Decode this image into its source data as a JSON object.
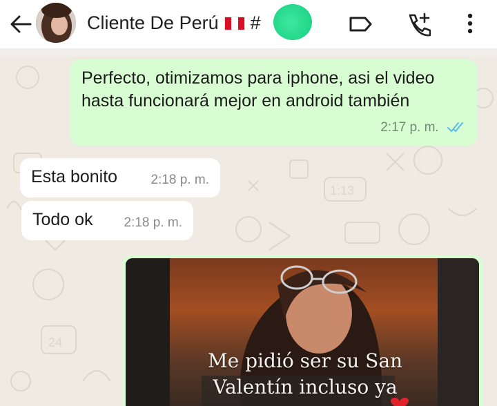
{
  "header": {
    "contact_name": "Cliente De Perú",
    "hash": "#",
    "icons": [
      "back-arrow-icon",
      "label-icon",
      "add-call-icon",
      "more-vert-icon"
    ]
  },
  "messages": [
    {
      "direction": "out",
      "text": "Perfecto, otimizamos para iphone, asi el video hasta funcionará mejor en android también",
      "time": "2:17 p. m.",
      "status": "read"
    },
    {
      "direction": "in",
      "text": "Esta bonito",
      "time": "2:18 p. m."
    },
    {
      "direction": "in",
      "text": "Todo ok",
      "time": "2:18 p. m."
    }
  ],
  "media": {
    "caption_line1": "Me pidió ser su San",
    "caption_line2": "Valentín incluso ya"
  },
  "colors": {
    "outgoing_bubble": "#d9fdd3",
    "incoming_bubble": "#ffffff",
    "wallpaper": "#efeae2",
    "read_ticks": "#53bdeb"
  }
}
